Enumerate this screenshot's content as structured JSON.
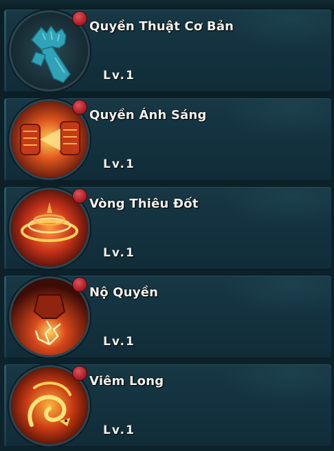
{
  "skills": [
    {
      "name": "Quyền Thuật Cơ Bản",
      "level": "Lv.1",
      "icon": "fist-gauntlet-icon",
      "locked": true
    },
    {
      "name": "Quyền Ánh Sáng",
      "level": "Lv.1",
      "icon": "light-fist-icon",
      "locked": false
    },
    {
      "name": "Vòng Thiêu Đốt",
      "level": "Lv.1",
      "icon": "fire-ring-icon",
      "locked": false
    },
    {
      "name": "Nộ Quyền",
      "level": "Lv.1",
      "icon": "rage-fist-icon",
      "locked": false
    },
    {
      "name": "Viêm Long",
      "level": "Lv.1",
      "icon": "flame-dragon-icon",
      "locked": false
    }
  ],
  "colors": {
    "card_bg": "#143240",
    "notify_dot": "#c0272f",
    "text": "#f2f2ee",
    "locked_icon": "#3aa7bd",
    "fire_core": "#ffd15a",
    "fire_outer": "#c5321a"
  }
}
